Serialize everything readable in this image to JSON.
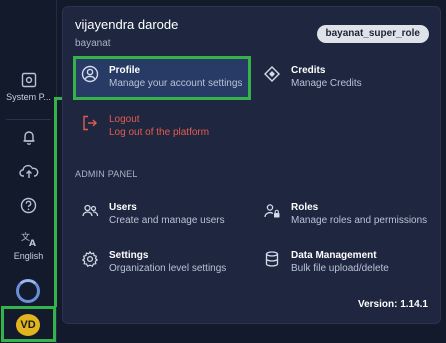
{
  "sidebar": {
    "system_label": "System P...",
    "language_label": "English",
    "avatar_initials": "VD"
  },
  "profile": {
    "name": "vijayendra darode",
    "org": "bayanat",
    "role": "bayanat_super_role"
  },
  "menu": {
    "profile": {
      "title": "Profile",
      "subtitle": "Manage your account settings"
    },
    "credits": {
      "title": "Credits",
      "subtitle": "Manage Credits"
    },
    "logout": {
      "title": "Logout",
      "subtitle": "Log out of the platform"
    }
  },
  "admin_panel": {
    "label": "ADMIN PANEL",
    "users": {
      "title": "Users",
      "subtitle": "Create and manage users"
    },
    "roles": {
      "title": "Roles",
      "subtitle": "Manage roles and permissions"
    },
    "settings": {
      "title": "Settings",
      "subtitle": "Organization level settings"
    },
    "data_management": {
      "title": "Data Management",
      "subtitle": "Bulk file upload/delete"
    }
  },
  "footer": {
    "version": "Version: 1.14.1"
  },
  "colors": {
    "accent_highlight": "#35b34a",
    "logout": "#e45b4e",
    "badge_bg": "#dfe2e8",
    "avatar_bg": "#e0b51f"
  }
}
